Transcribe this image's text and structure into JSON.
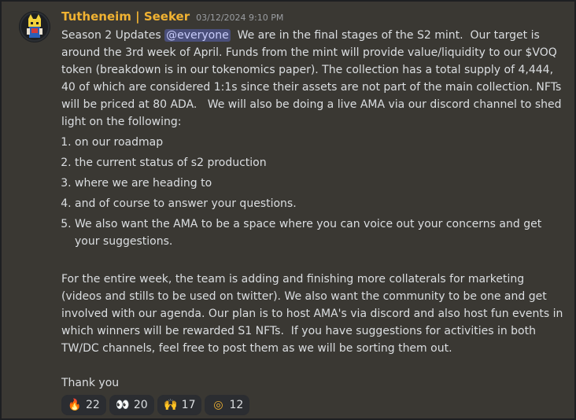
{
  "message": {
    "username": "Tutheneim | Seeker",
    "timestamp": "03/12/2024 9:10 PM",
    "intro_before_mention": "Season 2 Updates ",
    "mention": "@everyone",
    "intro_after_mention": "  We are in the final stages of the S2 mint.  Our target is around the 3rd week of April. Funds from the mint will provide value/liquidity to our $VOQ token (breakdown is in our tokenomics paper). The collection has a total supply of 4,444, 40 of which are considered 1:1s since their assets are not part of the main collection. NFTs will be priced at 80 ADA.   We will also be doing a live AMA via our discord channel to shed light on the following:",
    "list": [
      "on our roadmap",
      "the current status of s2 production",
      "where we are heading to",
      "and of course to answer your questions.",
      "We also want the AMA to be a space where you can voice out your concerns and get your suggestions."
    ],
    "paragraph2": "For the entire week, the team is adding and finishing more collaterals for marketing (videos and stills to be used on twitter). We also want the community to be one and get involved with our agenda. Our plan is to host AMA's via discord and also host fun events in which winners will be rewarded S1 NFTs.  If you have suggestions for activities in both TW/DC channels, feel free to post them as we will be sorting them out.",
    "signoff": "Thank you",
    "reactions": [
      {
        "icon": "fire-emoji",
        "glyph": "🔥",
        "count": "22"
      },
      {
        "icon": "eyes-emoji",
        "glyph": "👀",
        "count": "20"
      },
      {
        "icon": "hands-emoji",
        "glyph": "🙌",
        "count": "17"
      },
      {
        "icon": "target-emoji",
        "glyph": "◎",
        "count": "12"
      }
    ]
  },
  "colors": {
    "username": "#f0b232",
    "background": "#3a3833",
    "mention_bg": "#4a4f7a",
    "reaction_bg": "#2b2d31"
  }
}
